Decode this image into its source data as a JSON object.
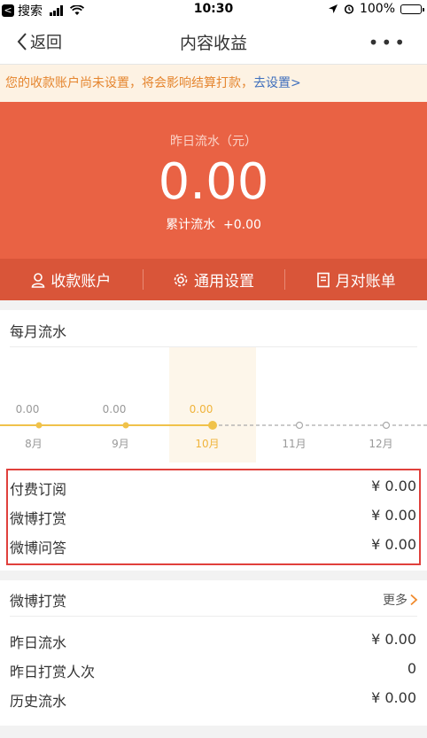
{
  "status_bar": {
    "carrier": "搜索",
    "time": "10:30",
    "battery": "100%"
  },
  "nav": {
    "back_label": "返回",
    "title": "内容收益",
    "more": "•••"
  },
  "notice": {
    "text": "您的收款账户尚未设置，将会影响结算打款，",
    "link": "去设置>"
  },
  "hero": {
    "label": "昨日流水（元）",
    "amount": "0.00",
    "cumulative_label": "累计流水",
    "cumulative_value": "+0.00"
  },
  "tabs": [
    {
      "label": "收款账户",
      "icon": "user-icon"
    },
    {
      "label": "通用设置",
      "icon": "gear-icon"
    },
    {
      "label": "月对账单",
      "icon": "bill-icon"
    }
  ],
  "monthly": {
    "title": "每月流水",
    "income_rows": [
      {
        "label": "付费订阅",
        "value": "¥ 0.00"
      },
      {
        "label": "微博打赏",
        "value": "¥ 0.00"
      },
      {
        "label": "微博问答",
        "value": "¥ 0.00"
      }
    ]
  },
  "chart_data": {
    "type": "line",
    "categories": [
      "8月",
      "9月",
      "10月",
      "11月",
      "12月"
    ],
    "series": [
      {
        "values": [
          0.0,
          0.0,
          0.0,
          null,
          null
        ],
        "labels": [
          "0.00",
          "0.00",
          "0.00",
          "",
          ""
        ]
      }
    ],
    "highlighted_category": "10月",
    "colors": {
      "line": "#f0c24a",
      "future": "#aaaaaa",
      "highlight_text": "#f0b43c"
    }
  },
  "reward": {
    "title": "微博打赏",
    "more": "更多",
    "rows": [
      {
        "label": "昨日流水",
        "value": "¥ 0.00"
      },
      {
        "label": "昨日打赏人次",
        "value": "0"
      },
      {
        "label": "历史流水",
        "value": "¥ 0.00"
      }
    ]
  }
}
